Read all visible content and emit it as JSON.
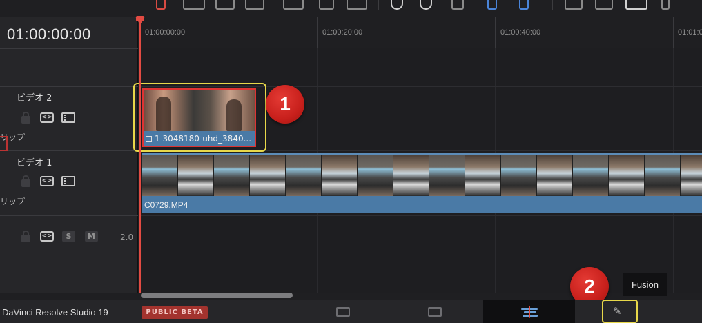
{
  "timecode": "01:00:00:00",
  "ruler": {
    "ticks": [
      "01:00:00:00",
      "01:00:20:00",
      "01:00:40:00",
      "01:01:0"
    ]
  },
  "tracks": {
    "v2": {
      "name": "ビデオ 2",
      "clip_label": "リップ"
    },
    "v1": {
      "name": "ビデオ 1",
      "clip_label": "リップ"
    },
    "a1": {
      "solo": "S",
      "mute": "M",
      "volume": "2.0"
    }
  },
  "clips": {
    "v2_clip_name": "1 3048180-uhd_3840...",
    "v1_clip_name": "C0729.MP4"
  },
  "bottom": {
    "app_name": "DaVinci Resolve Studio 19",
    "beta_label": "PUBLIC BETA",
    "active_page": "edit",
    "fusion_tooltip": "Fusion"
  },
  "annotations": {
    "badge_1": "1",
    "badge_2": "2"
  },
  "colors": {
    "playhead": "#e24b43",
    "clip_blue": "#4a7aa6",
    "highlight": "#e8d84a",
    "badge_red": "#c8201c"
  }
}
